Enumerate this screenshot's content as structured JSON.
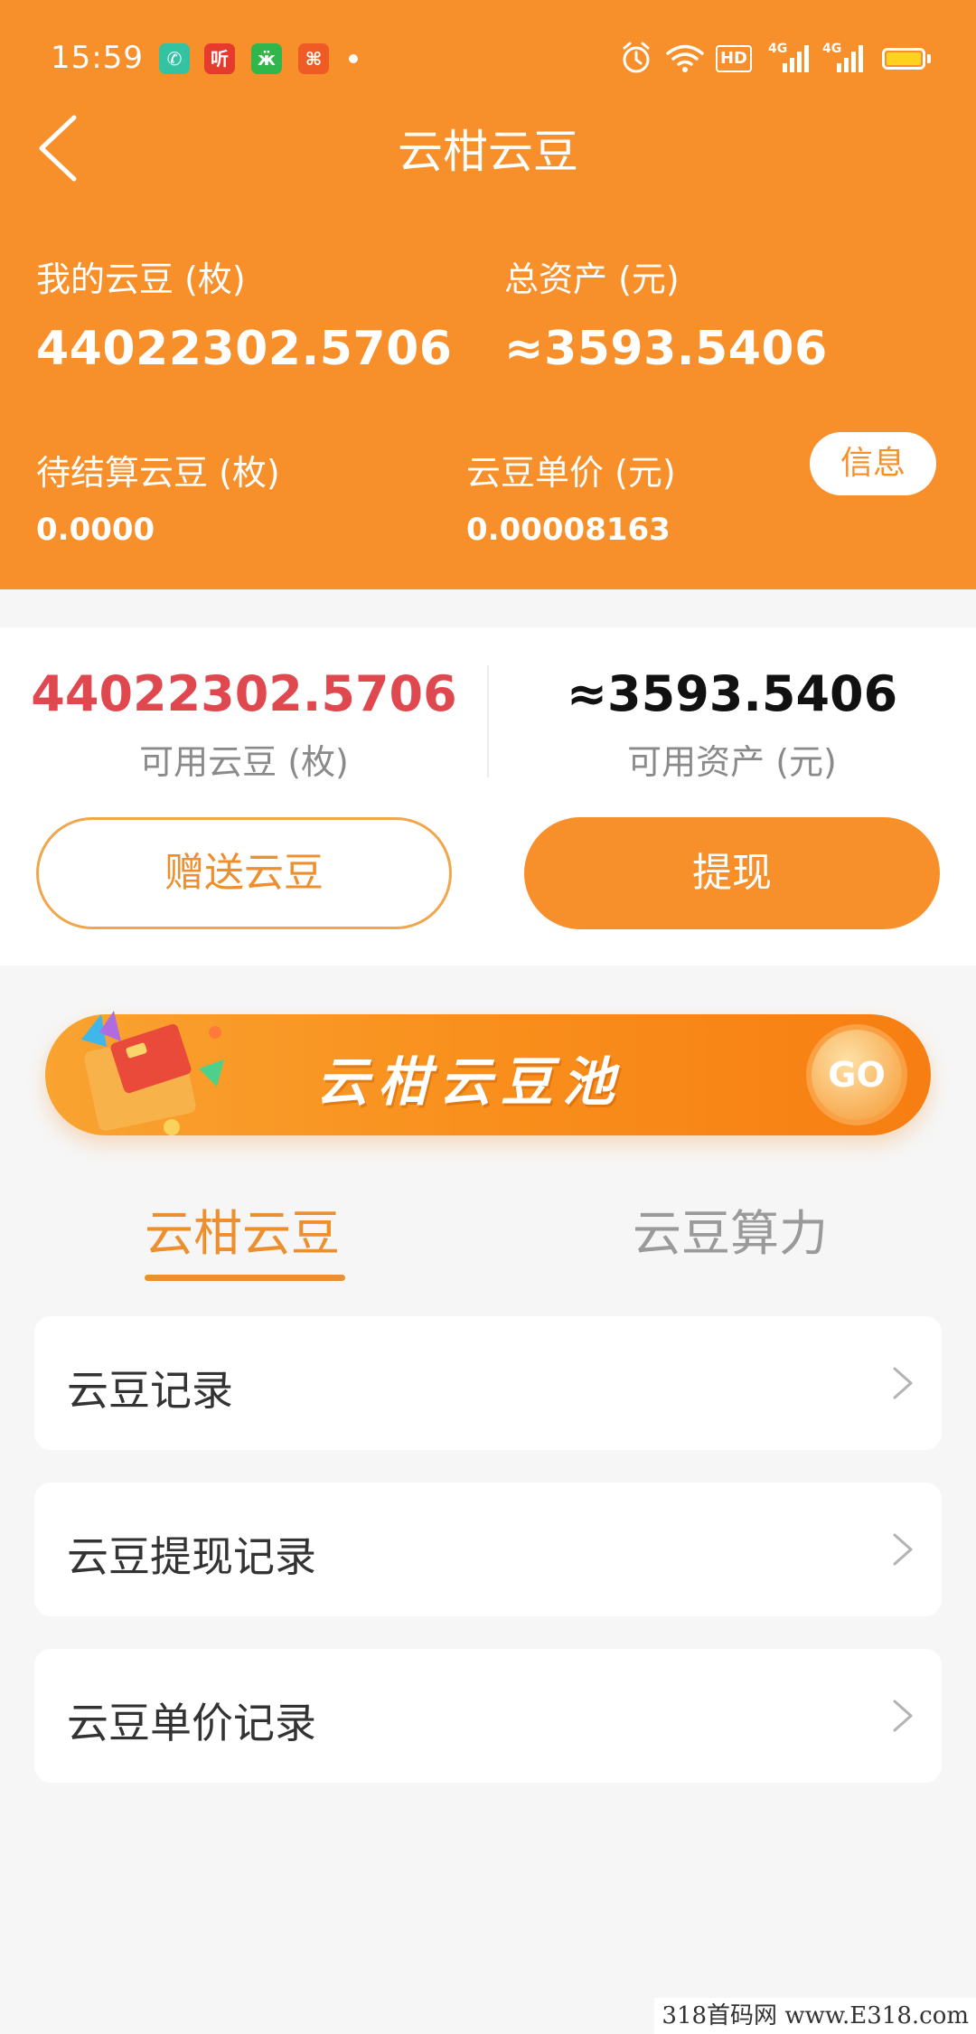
{
  "status_bar": {
    "time": "15:59",
    "app_icons": [
      {
        "name": "phone-app-icon",
        "glyph": "✆",
        "color": "#33c2a2"
      },
      {
        "name": "ting-app-icon",
        "glyph": "听",
        "color": "#e53b2c"
      },
      {
        "name": "green-app-icon",
        "glyph": "ӝ",
        "color": "#31b64b"
      },
      {
        "name": "orange-app-icon",
        "glyph": "⌘",
        "color": "#ee5b25"
      }
    ],
    "hd_label": "HD",
    "sim1_label": "4G",
    "sim2_label": "4G"
  },
  "nav": {
    "title": "云柑云豆"
  },
  "header": {
    "my_beans_label": "我的云豆 (枚)",
    "my_beans_value": "44022302.5706",
    "total_assets_label": "总资产 (元)",
    "total_assets_value": "≈3593.5406",
    "pending_label": "待结算云豆 (枚)",
    "pending_value": "0.0000",
    "unit_price_label": "云豆单价 (元)",
    "unit_price_value": "0.00008163",
    "info_button": "信息"
  },
  "balance": {
    "available_beans_value": "44022302.5706",
    "available_beans_label": "可用云豆 (枚)",
    "available_assets_value": "≈3593.5406",
    "available_assets_label": "可用资产 (元)",
    "gift_button": "赠送云豆",
    "withdraw_button": "提现"
  },
  "banner": {
    "title": "云柑云豆池",
    "go_label": "GO"
  },
  "tabs": [
    {
      "label": "云柑云豆",
      "active": true
    },
    {
      "label": "云豆算力",
      "active": false
    }
  ],
  "list": [
    {
      "label": "云豆记录"
    },
    {
      "label": "云豆提现记录"
    },
    {
      "label": "云豆单价记录"
    }
  ],
  "watermark": "318首码网 www.E318.com",
  "colors": {
    "brand_orange": "#f7902a",
    "accent_red": "#e0484f",
    "tab_active": "#ec8f2f"
  }
}
